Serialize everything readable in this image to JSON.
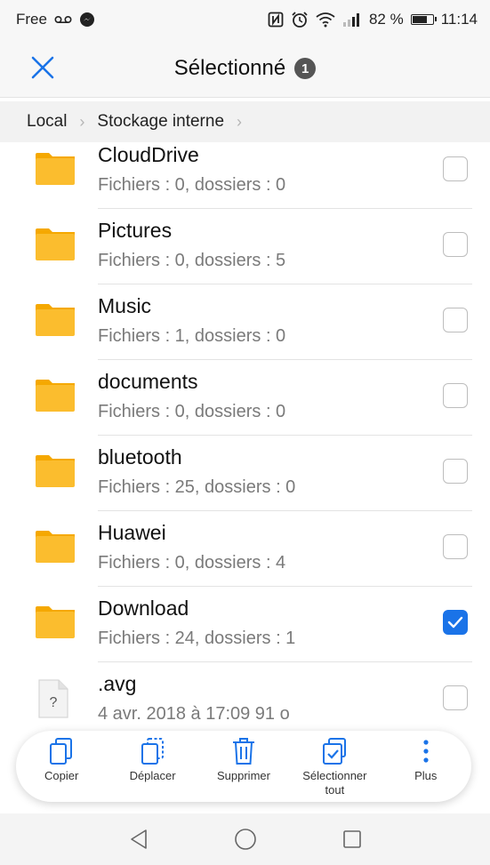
{
  "status_bar": {
    "carrier": "Free",
    "battery_text": "82 %",
    "battery_level": 0.82,
    "time": "11:14",
    "icons": [
      "voicemail-icon",
      "messenger-icon",
      "nfc-icon",
      "alarm-icon",
      "wifi-icon",
      "signal-icon",
      "battery-icon"
    ]
  },
  "header": {
    "title": "Sélectionné",
    "selected_count": "1",
    "close_icon": "close-icon"
  },
  "breadcrumb": {
    "items": [
      "Local",
      "Stockage interne"
    ]
  },
  "files": [
    {
      "name": "CloudDrive",
      "meta": "Fichiers : 0, dossiers : 0",
      "type": "folder",
      "checked": false
    },
    {
      "name": "Pictures",
      "meta": "Fichiers : 0, dossiers : 5",
      "type": "folder",
      "checked": false
    },
    {
      "name": "Music",
      "meta": "Fichiers : 1, dossiers : 0",
      "type": "folder",
      "checked": false
    },
    {
      "name": "documents",
      "meta": "Fichiers : 0, dossiers : 0",
      "type": "folder",
      "checked": false
    },
    {
      "name": "bluetooth",
      "meta": "Fichiers : 25, dossiers : 0",
      "type": "folder",
      "checked": false
    },
    {
      "name": "Huawei",
      "meta": "Fichiers : 0, dossiers : 4",
      "type": "folder",
      "checked": false
    },
    {
      "name": "Download",
      "meta": "Fichiers : 24, dossiers : 1",
      "type": "folder",
      "checked": true
    },
    {
      "name": ".avg",
      "meta": "4 avr. 2018 à 17:09 91  o",
      "type": "file",
      "checked": false
    }
  ],
  "toolbar": {
    "copy": "Copier",
    "move": "Déplacer",
    "delete": "Supprimer",
    "select_all_line1": "Sélectionner",
    "select_all_line2": "tout",
    "more": "Plus"
  },
  "colors": {
    "accent": "#1a73e8",
    "folder": "#fbbd2e",
    "folder_tab": "#f5a800"
  }
}
